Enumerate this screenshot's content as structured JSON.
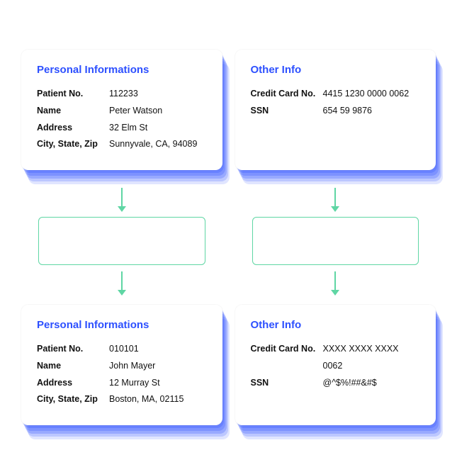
{
  "top_left": {
    "title": "Personal Informations",
    "rows": [
      {
        "label": "Patient No.",
        "value": "112233"
      },
      {
        "label": "Name",
        "value": "Peter Watson"
      },
      {
        "label": "Address",
        "value": "32 Elm St"
      },
      {
        "label": "City, State, Zip",
        "value": "Sunnyvale, CA, 94089"
      }
    ]
  },
  "top_right": {
    "title": "Other Info",
    "rows": [
      {
        "label": "Credit Card No.",
        "value": "4415 1230 0000 0062"
      },
      {
        "label": "SSN",
        "value": "654 59 9876"
      }
    ]
  },
  "bottom_left": {
    "title": "Personal Informations",
    "rows": [
      {
        "label": "Patient No.",
        "value": "010101"
      },
      {
        "label": "Name",
        "value": "John Mayer"
      },
      {
        "label": "Address",
        "value": "12 Murray St"
      },
      {
        "label": "City, State, Zip",
        "value": "Boston, MA, 02115"
      }
    ]
  },
  "bottom_right": {
    "title": "Other Info",
    "rows": [
      {
        "label": "Credit Card No.",
        "value": "XXXX XXXX XXXX 0062"
      },
      {
        "label": "SSN",
        "value": "@^$%!##&#$"
      }
    ]
  }
}
